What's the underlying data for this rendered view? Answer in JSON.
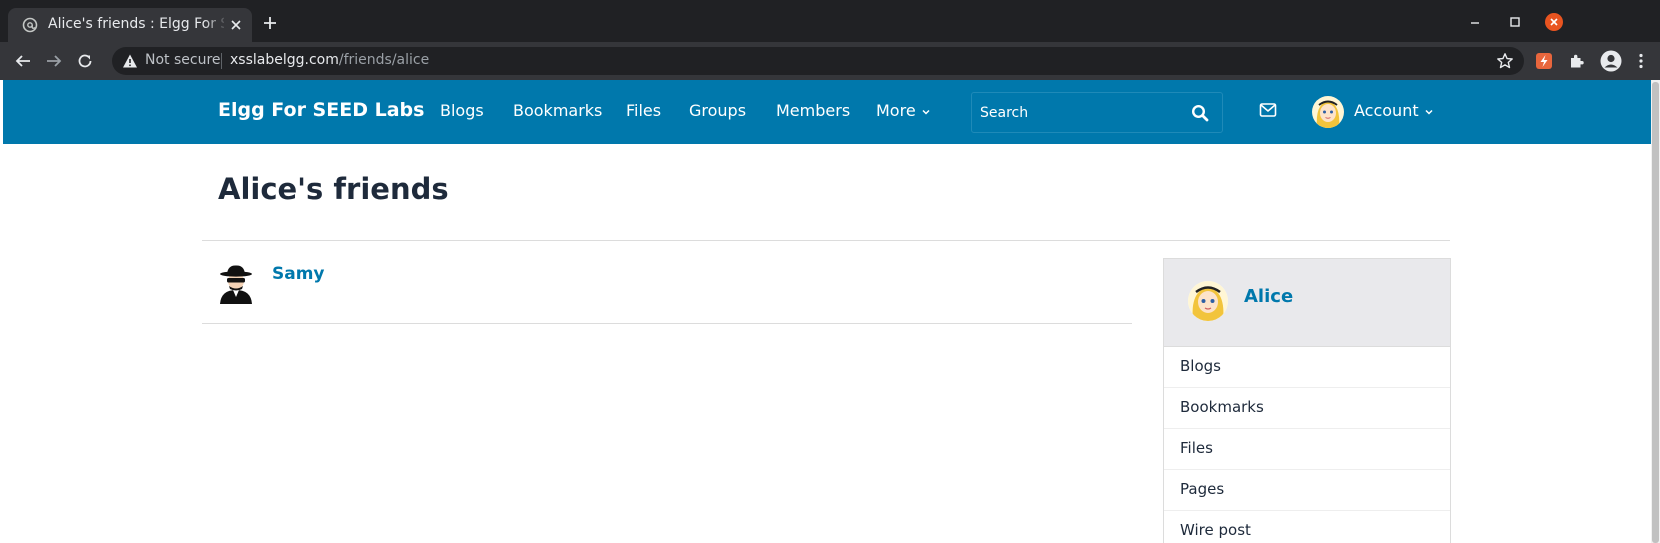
{
  "browser": {
    "tab_title": "Alice's friends : Elgg For SEED Labs",
    "not_secure_label": "Not secure",
    "url_host": "xsslabelgg.com",
    "url_path": "/friends/alice"
  },
  "site": {
    "name": "Elgg For SEED Labs",
    "menu": [
      "Blogs",
      "Bookmarks",
      "Files",
      "Groups",
      "Members"
    ],
    "more_label": "More",
    "search_placeholder": "Search",
    "account_label": "Account",
    "brand_color": "#0078ac"
  },
  "page": {
    "title": "Alice's friends",
    "friends": [
      {
        "name": "Samy",
        "avatar_icon": "spy-avatar-icon"
      }
    ]
  },
  "owner": {
    "name": "Alice",
    "avatar_icon": "alice-avatar-icon",
    "menu": [
      "Blogs",
      "Bookmarks",
      "Files",
      "Pages",
      "Wire post"
    ]
  }
}
